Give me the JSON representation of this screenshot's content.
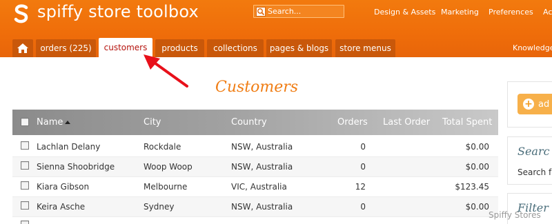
{
  "brand": {
    "name": "spiffy store toolbox"
  },
  "search": {
    "placeholder": "Search..."
  },
  "top_nav": [
    "Design & Assets",
    "Marketing",
    "Preferences",
    "Ac"
  ],
  "knowledge_link": "Knowledge",
  "tabs": {
    "home_icon": "home-icon",
    "items": [
      {
        "label": "orders (225)",
        "active": false
      },
      {
        "label": "customers",
        "active": true
      },
      {
        "label": "products",
        "active": false
      },
      {
        "label": "collections",
        "active": false
      },
      {
        "label": "pages & blogs",
        "active": false
      },
      {
        "label": "store menus",
        "active": false
      }
    ]
  },
  "page": {
    "title": "Customers"
  },
  "table": {
    "columns": [
      "Name",
      "City",
      "Country",
      "Orders",
      "Last Order",
      "Total Spent"
    ],
    "sorted_by": "Name",
    "rows": [
      {
        "name": "Lachlan Delany",
        "city": "Rockdale",
        "country": "NSW, Australia",
        "orders": "0",
        "last_order": "",
        "total": "$0.00"
      },
      {
        "name": "Sienna Shoobridge",
        "city": "Woop Woop",
        "country": "NSW, Australia",
        "orders": "0",
        "last_order": "",
        "total": "$0.00"
      },
      {
        "name": "Kiara Gibson",
        "city": "Melbourne",
        "country": "VIC, Australia",
        "orders": "12",
        "last_order": "",
        "total": "$123.45"
      },
      {
        "name": "Keira Asche",
        "city": "Sydney",
        "country": "NSW, Australia",
        "orders": "0",
        "last_order": "",
        "total": "$0.00"
      }
    ]
  },
  "sidebar": {
    "add_button": "ad",
    "search_heading": "Searc",
    "search_text": "Search fo",
    "filter_heading": "Filter c"
  },
  "watermark": "Spiffy Stores",
  "colors": {
    "header": "#ef6d0a",
    "tab": "#c9580a",
    "active_tab_text": "#b5120c",
    "title": "#f07d14",
    "annotation_arrow": "#e8101a"
  }
}
